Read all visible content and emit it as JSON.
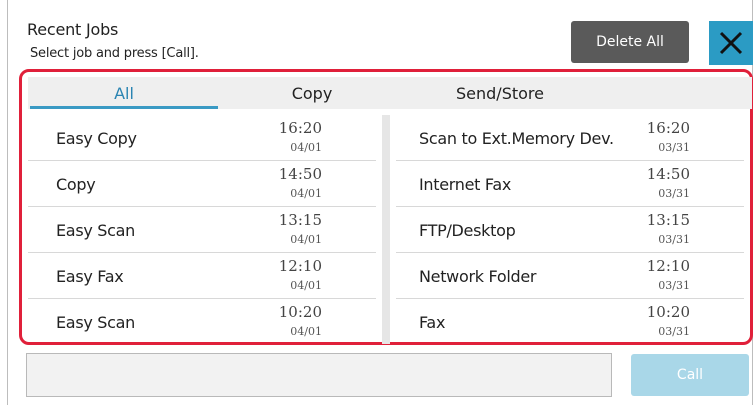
{
  "header": {
    "title": "Recent Jobs",
    "subtitle": "Select job and press [Call].",
    "delete_all_label": "Delete All",
    "close_icon": "close-icon"
  },
  "tabs": [
    {
      "label": "All",
      "active": true
    },
    {
      "label": "Copy",
      "active": false
    },
    {
      "label": "Send/Store",
      "active": false
    }
  ],
  "jobs_left": [
    {
      "name": "Easy Copy",
      "time": "16:20",
      "date": "04/01"
    },
    {
      "name": "Copy",
      "time": "14:50",
      "date": "04/01"
    },
    {
      "name": "Easy Scan",
      "time": "13:15",
      "date": "04/01"
    },
    {
      "name": "Easy Fax",
      "time": "12:10",
      "date": "04/01"
    },
    {
      "name": "Easy Scan",
      "time": "10:20",
      "date": "04/01"
    }
  ],
  "jobs_right": [
    {
      "name": "Scan to Ext.Memory Dev.",
      "time": "16:20",
      "date": "03/31"
    },
    {
      "name": "Internet Fax",
      "time": "14:50",
      "date": "03/31"
    },
    {
      "name": "FTP/Desktop",
      "time": "13:15",
      "date": "03/31"
    },
    {
      "name": "Network Folder",
      "time": "12:10",
      "date": "03/31"
    },
    {
      "name": "Fax",
      "time": "10:20",
      "date": "03/31"
    }
  ],
  "footer": {
    "call_label": "Call"
  },
  "colors": {
    "accent": "#2b9bc4",
    "highlight_border": "#e0203a",
    "dark_button": "#5a5a5a"
  }
}
